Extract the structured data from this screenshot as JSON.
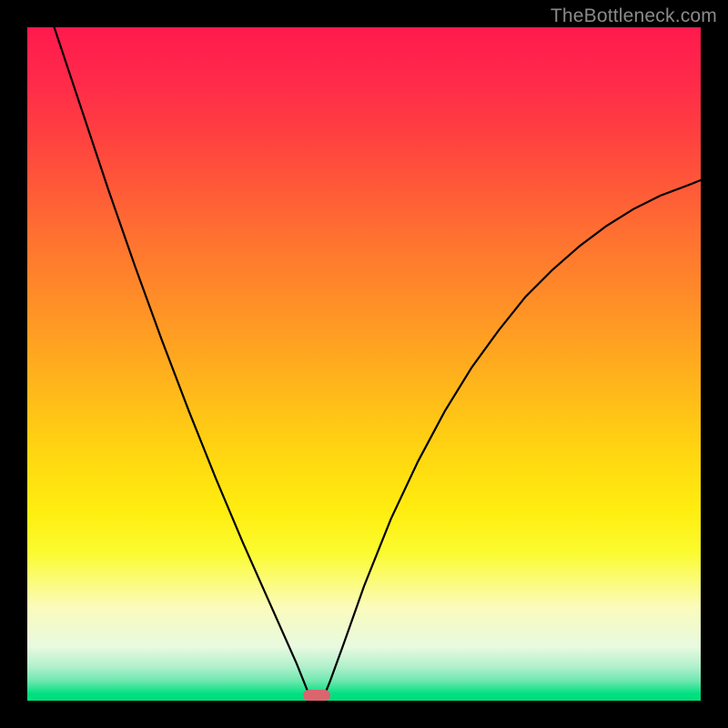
{
  "watermark": "TheBottleneck.com",
  "chart_data": {
    "type": "line",
    "title": "",
    "xlabel": "",
    "ylabel": "",
    "xlim": [
      0,
      100
    ],
    "ylim": [
      0,
      100
    ],
    "grid": false,
    "legend": false,
    "background_gradient": {
      "top_color": "#ff1a4d",
      "bottom_color": "#00dd78",
      "description": "vertical red-to-yellow-to-green gradient"
    },
    "series": [
      {
        "name": "left-branch",
        "x": [
          4.0,
          8.0,
          12.0,
          16.0,
          20.0,
          24.0,
          28.0,
          32.0,
          36.0,
          38.0,
          40.0,
          41.0,
          42.0
        ],
        "values": [
          100.0,
          88.0,
          76.0,
          64.5,
          53.5,
          43.0,
          33.0,
          23.5,
          14.5,
          10.0,
          5.5,
          3.0,
          0.5
        ]
      },
      {
        "name": "right-branch",
        "x": [
          44.0,
          45.0,
          47.0,
          50.0,
          54.0,
          58.0,
          62.0,
          66.0,
          70.0,
          74.0,
          78.0,
          82.0,
          86.0,
          90.0,
          94.0,
          98.0,
          100.0
        ],
        "values": [
          0.5,
          3.0,
          8.5,
          17.0,
          27.0,
          35.5,
          43.0,
          49.5,
          55.0,
          60.0,
          64.0,
          67.5,
          70.5,
          73.0,
          75.0,
          76.5,
          77.3
        ]
      }
    ],
    "minimum_marker": {
      "x_center": 43.0,
      "x_width": 4.0,
      "color": "#d9666f"
    },
    "frame_color": "#000000"
  }
}
